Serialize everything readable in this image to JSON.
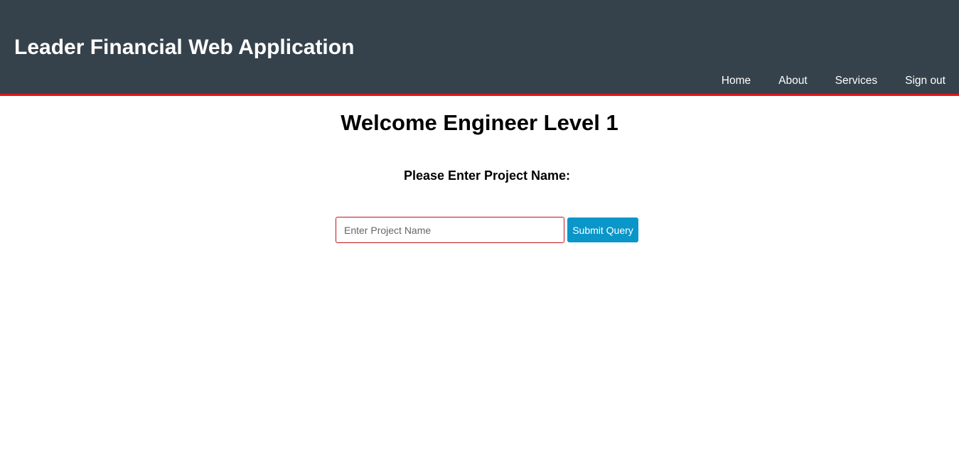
{
  "header": {
    "title": "Leader Financial Web Application",
    "nav": [
      {
        "label": "Home"
      },
      {
        "label": "About"
      },
      {
        "label": "Services"
      },
      {
        "label": "Sign out"
      }
    ]
  },
  "main": {
    "welcome": "Welcome Engineer Level 1",
    "prompt": "Please Enter Project Name:",
    "input": {
      "value": "",
      "placeholder": "Enter Project Name"
    },
    "submit_label": "Submit Query"
  },
  "colors": {
    "header_bg": "#36424b",
    "header_border": "#e0161e",
    "button_bg": "#0a96c9",
    "input_border": "#c0171c"
  }
}
